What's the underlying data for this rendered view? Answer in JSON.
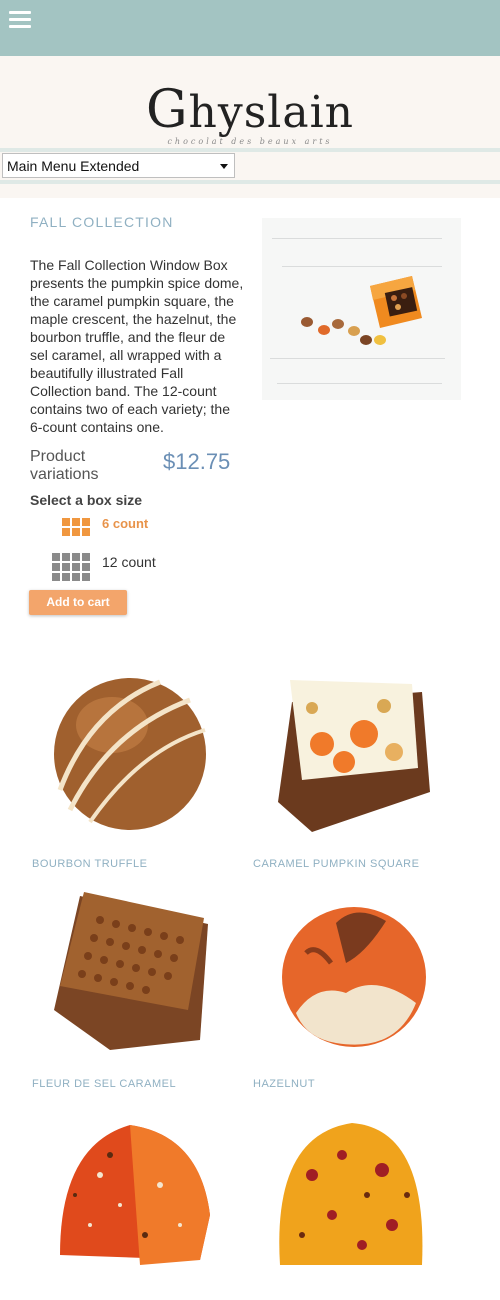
{
  "header": {
    "menu_icon": "hamburger-menu-icon",
    "bg_color": "#a3c4c2"
  },
  "brand": {
    "logo_initial": "G",
    "logo_rest": "hyslain",
    "tagline": "chocolat des beaux arts"
  },
  "nav": {
    "menu_select_value": "Main Menu Extended"
  },
  "product": {
    "collection_title": "FALL COLLECTION",
    "description": "The Fall Collection Window Box presents the pumpkin spice dome, the caramel pumpkin square, the maple crescent, the hazelnut, the bourbon truffle, and the fleur de sel caramel, all wrapped with a beautifully illustrated Fall Collection band. The 12-count contains two of each variety; the 6-count contains one.",
    "variations_label_line1": "Product",
    "variations_label_line2": "variations",
    "price": "$12.75",
    "select_label": "Select a box size",
    "options": [
      {
        "label": "6 count",
        "selected": true
      },
      {
        "label": "12 count",
        "selected": false
      }
    ],
    "add_to_cart": "Add to cart"
  },
  "chocolates": [
    {
      "name": "BOURBON TRUFFLE"
    },
    {
      "name": "CARAMEL PUMPKIN SQUARE"
    },
    {
      "name": "FLEUR DE SEL CARAMEL"
    },
    {
      "name": "HAZELNUT"
    },
    {
      "name": ""
    },
    {
      "name": ""
    }
  ],
  "colors": {
    "accent_orange": "#f3a56b",
    "label_blue": "#8fb0c2",
    "price_blue": "#6b8fb5"
  }
}
